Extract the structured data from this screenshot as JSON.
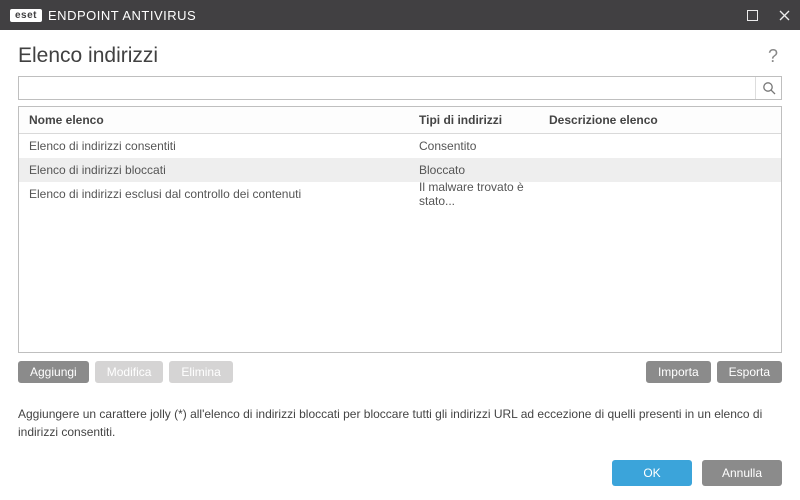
{
  "titlebar": {
    "brand_badge": "eset",
    "product_name": "ENDPOINT ANTIVIRUS"
  },
  "page": {
    "title": "Elenco indirizzi",
    "help_tooltip": "?"
  },
  "search": {
    "value": "",
    "placeholder": ""
  },
  "table": {
    "headers": {
      "name": "Nome elenco",
      "type": "Tipi di indirizzi",
      "desc": "Descrizione elenco"
    },
    "rows": [
      {
        "name": "Elenco di indirizzi consentiti",
        "type": "Consentito",
        "desc": "",
        "selected": false
      },
      {
        "name": "Elenco di indirizzi bloccati",
        "type": "Bloccato",
        "desc": "",
        "selected": true
      },
      {
        "name": "Elenco di indirizzi esclusi dal controllo dei contenuti",
        "type": "Il malware trovato è stato...",
        "desc": "",
        "selected": false
      }
    ]
  },
  "actions": {
    "add": "Aggiungi",
    "edit": "Modifica",
    "delete": "Elimina",
    "import": "Importa",
    "export": "Esporta"
  },
  "hint": "Aggiungere un carattere jolly (*) all'elenco di indirizzi bloccati per bloccare tutti gli indirizzi URL ad eccezione di quelli presenti in un elenco di indirizzi consentiti.",
  "footer": {
    "ok": "OK",
    "cancel": "Annulla"
  }
}
